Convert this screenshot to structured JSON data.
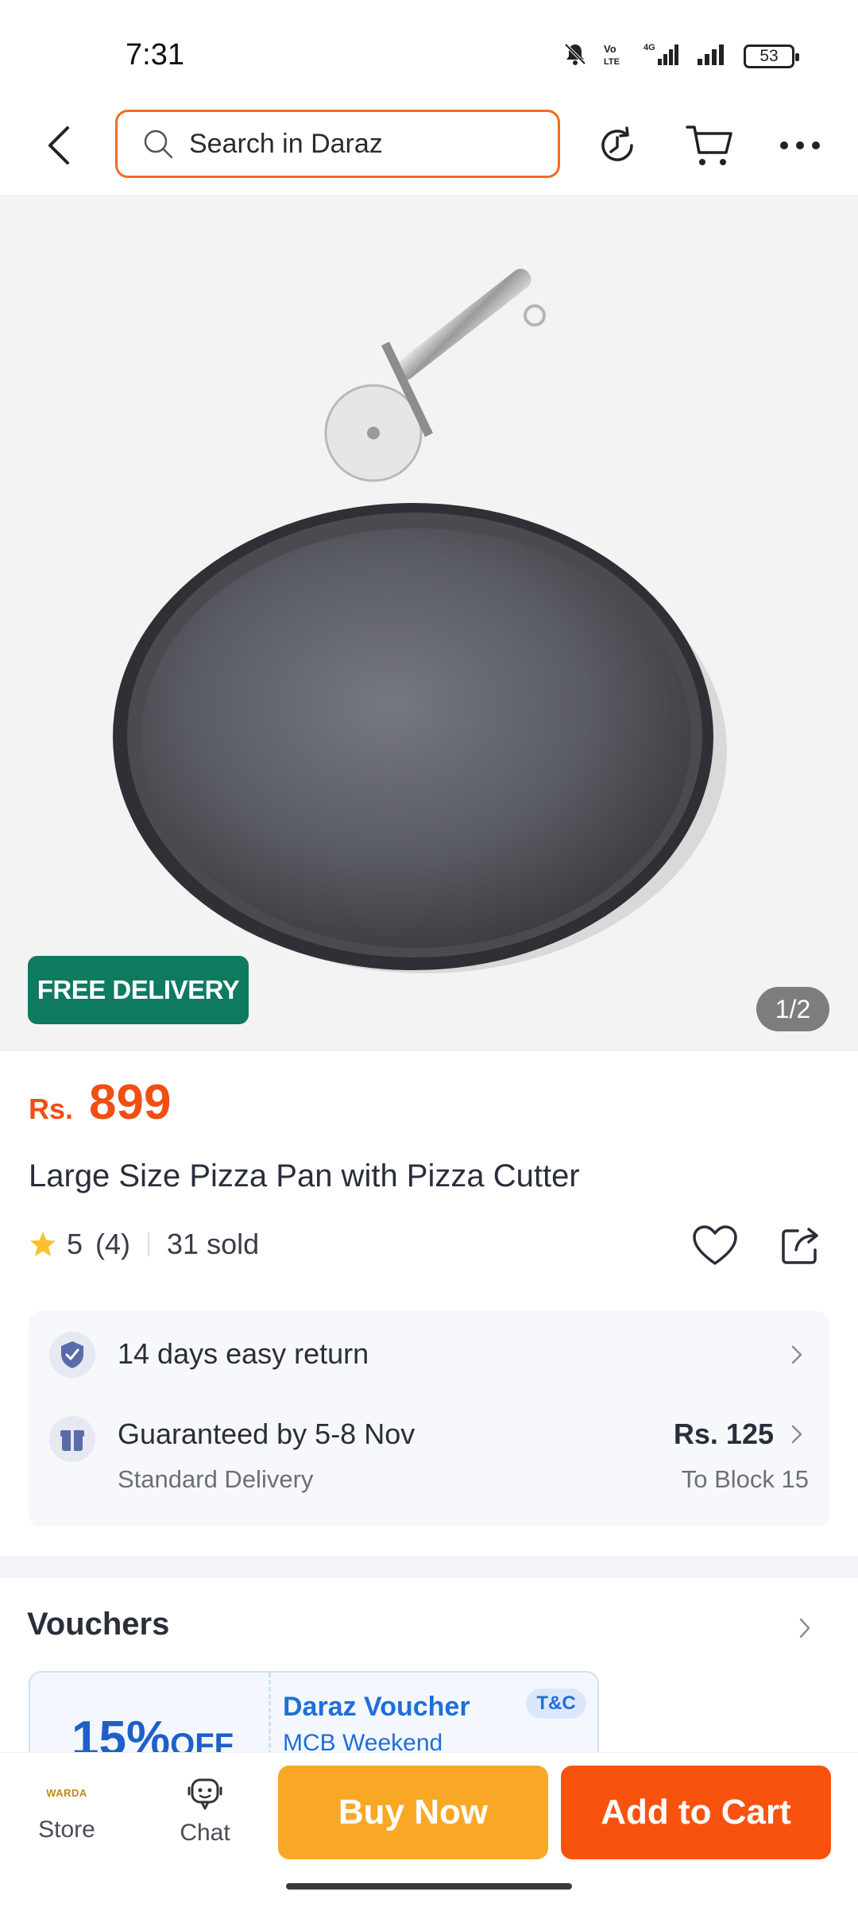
{
  "status_bar": {
    "time": "7:31",
    "battery": "53",
    "icons": [
      "bell-off-icon",
      "volte-icon",
      "signal-4g-icon",
      "signal-icon",
      "battery-icon"
    ]
  },
  "header": {
    "search_placeholder": "Search in Daraz",
    "icons": [
      "back-icon",
      "search-icon",
      "history-icon",
      "cart-icon",
      "more-icon"
    ],
    "accent": "#f46a1f"
  },
  "product": {
    "badge": "FREE DELIVERY",
    "pager": "1/2",
    "currency": "Rs.",
    "price": "899",
    "title": "Large Size Pizza Pan with Pizza Cutter",
    "rating": "5",
    "rating_count": "(4)",
    "sold": "31 sold",
    "price_color": "#f04e12"
  },
  "services": {
    "return_text": "14 days easy return",
    "delivery_text": "Guaranteed by 5-8 Nov",
    "delivery_type": "Standard Delivery",
    "delivery_fee": "Rs. 125",
    "delivery_to": "To Block 15"
  },
  "vouchers": {
    "title": "Vouchers",
    "items": [
      {
        "percent": "15%",
        "off": "OFF",
        "name": "Daraz Voucher",
        "subtitle": "MCB Weekend",
        "tnc": "T&C"
      }
    ]
  },
  "bottom_bar": {
    "store_label": "Store",
    "store_logo": "WARDA",
    "chat_label": "Chat",
    "buy_now": "Buy Now",
    "add_to_cart": "Add to Cart",
    "buy_color": "#f9a825",
    "cart_color": "#f7530f"
  }
}
